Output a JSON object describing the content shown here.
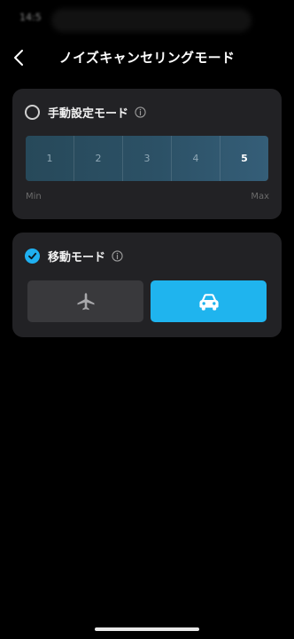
{
  "status_bar": {
    "time": "14:5",
    "right": ""
  },
  "nav": {
    "title": "ノイズキャンセリングモード",
    "back_icon": "chevron-left-icon"
  },
  "manual_mode": {
    "label": "手動設定モード",
    "selected": false,
    "info_icon": "info-icon",
    "levels": [
      "1",
      "2",
      "3",
      "4",
      "5"
    ],
    "current_level": 5,
    "min_label": "Min",
    "max_label": "Max"
  },
  "move_mode": {
    "label": "移動モード",
    "selected": true,
    "info_icon": "info-icon",
    "options": [
      {
        "icon": "airplane-icon",
        "selected": false
      },
      {
        "icon": "car-icon",
        "selected": true
      }
    ]
  },
  "colors": {
    "accent": "#1fb4ee",
    "card_bg": "#222225",
    "track_left": "#27495a",
    "track_right": "#355e78"
  }
}
